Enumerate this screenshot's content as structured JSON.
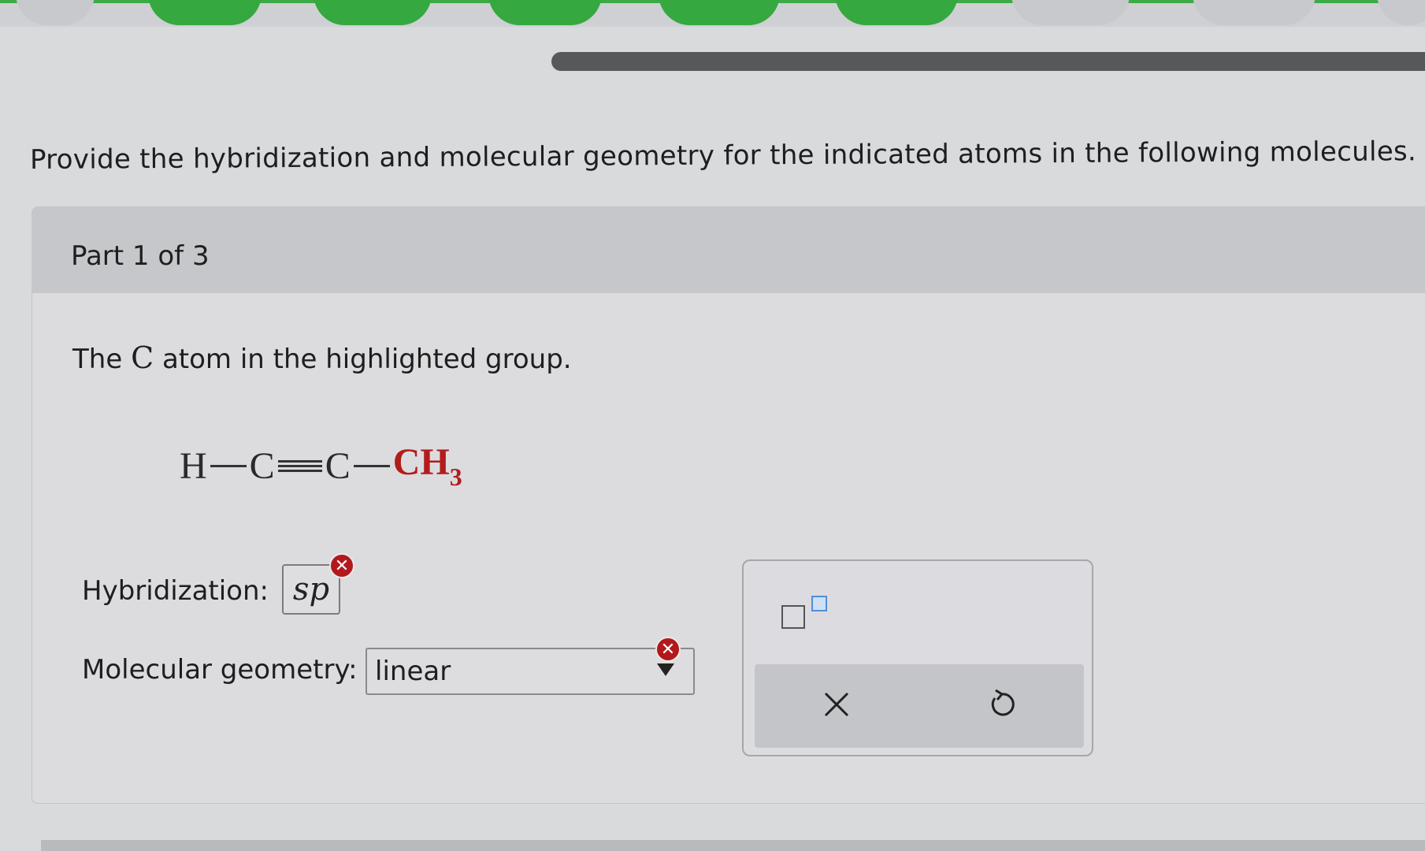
{
  "question": {
    "text": "Provide the hybridization and molecular geometry for the indicated atoms in the following molecules."
  },
  "part": {
    "title": "Part 1 of 3",
    "prompt_before": "The",
    "prompt_atom": "C",
    "prompt_after": "atom in the highlighted group."
  },
  "molecule": {
    "atom1": "H",
    "atom2": "C",
    "atom3": "C",
    "highlighted_group": "CH",
    "highlighted_subscript": "3",
    "highlight_color": "#b21c1c"
  },
  "hybridization": {
    "label": "Hybridization:",
    "value": "sp",
    "status": "incorrect"
  },
  "geometry": {
    "label": "Molecular geometry:",
    "value": "linear",
    "status": "incorrect"
  },
  "tools": {
    "superscript_icon": "superscript-box-icon",
    "clear_icon": "x-icon",
    "undo_icon": "undo-icon"
  },
  "colors": {
    "progress_done": "#35a83f",
    "error": "#b3181c"
  }
}
